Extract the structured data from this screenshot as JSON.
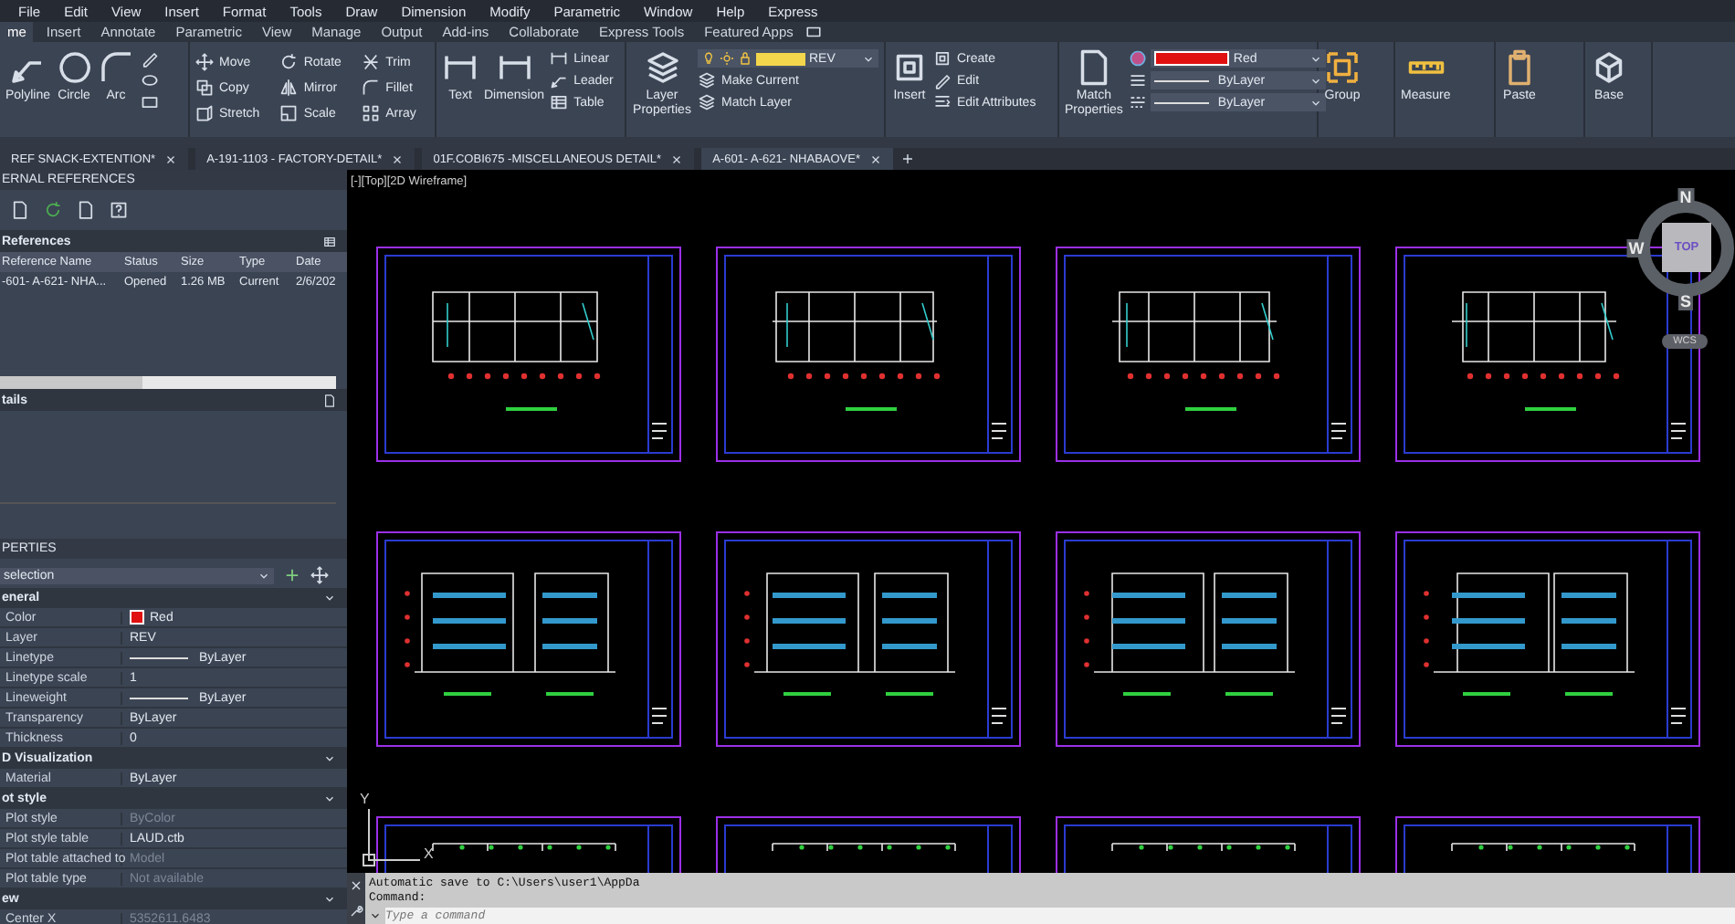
{
  "menu_bar": {
    "items": [
      "File",
      "Edit",
      "View",
      "Insert",
      "Format",
      "Tools",
      "Draw",
      "Dimension",
      "Modify",
      "Parametric",
      "Window",
      "Help",
      "Express"
    ]
  },
  "ribbon_tabs": [
    {
      "label": "me",
      "selected": true
    },
    {
      "label": "Insert",
      "selected": false
    },
    {
      "label": "Annotate",
      "selected": false
    },
    {
      "label": "Parametric",
      "selected": false
    },
    {
      "label": "View",
      "selected": false
    },
    {
      "label": "Manage",
      "selected": false
    },
    {
      "label": "Output",
      "selected": false
    },
    {
      "label": "Add-ins",
      "selected": false
    },
    {
      "label": "Collaborate",
      "selected": false
    },
    {
      "label": "Express Tools",
      "selected": false
    },
    {
      "label": "Featured Apps",
      "selected": false
    }
  ],
  "ribbon": {
    "draw": {
      "buttons": [
        "Polyline",
        "Circle",
        "Arc"
      ]
    },
    "modify": {
      "tools": [
        "Move",
        "Rotate",
        "Trim",
        "Copy",
        "Mirror",
        "Fillet",
        "Stretch",
        "Scale",
        "Array"
      ]
    },
    "annotation": {
      "buttons": [
        "Text",
        "Dimension"
      ],
      "tools": [
        "Linear",
        "Leader",
        "Table"
      ]
    },
    "layers": {
      "button": "Layer Properties",
      "current_layer": "REV",
      "tools": [
        "Make Current",
        "Match Layer"
      ]
    },
    "block": {
      "button": "Insert",
      "tools": [
        "Create",
        "Edit",
        "Edit Attributes"
      ]
    },
    "properties": {
      "button": "Match Properties",
      "color_name": "Red",
      "linetype": "ByLayer",
      "lineweight": "ByLayer"
    },
    "groups": {
      "button": "Group"
    },
    "utilities": {
      "button": "Measure"
    },
    "clipboard": {
      "button": "Paste"
    },
    "view": {
      "button": "Base"
    }
  },
  "document_tabs": [
    {
      "label": "REF SNACK-EXTENTION*",
      "selected": false
    },
    {
      "label": "A-191-1103 - FACTORY-DETAIL*",
      "selected": false
    },
    {
      "label": "01F.COBI675 -MISCELLANEOUS DETAIL*",
      "selected": false
    },
    {
      "label": "A-601- A-621- NHABAOVE*",
      "selected": true
    }
  ],
  "xref_palette": {
    "title": "ERNAL REFERENCES",
    "section": "References",
    "columns": [
      "Reference Name",
      "Status",
      "Size",
      "Type",
      "Date"
    ],
    "rows": [
      [
        "-601- A-621- NHA...",
        "Opened",
        "1.26 MB",
        "Current",
        "2/6/202"
      ]
    ],
    "details_title": "tails"
  },
  "properties_palette": {
    "title": "PERTIES",
    "selection": "selection",
    "groups": [
      {
        "title": "eneral",
        "rows": [
          {
            "label": "Color",
            "value": "Red",
            "kind": "color",
            "disabled": false
          },
          {
            "label": "Layer",
            "value": "REV",
            "kind": "text",
            "disabled": false
          },
          {
            "label": "Linetype",
            "value": "ByLayer",
            "kind": "line",
            "disabled": false
          },
          {
            "label": "Linetype scale",
            "value": "1",
            "kind": "text",
            "disabled": false
          },
          {
            "label": "Lineweight",
            "value": "ByLayer",
            "kind": "line",
            "disabled": false
          },
          {
            "label": "Transparency",
            "value": "ByLayer",
            "kind": "text",
            "disabled": false
          },
          {
            "label": "Thickness",
            "value": "0",
            "kind": "text",
            "disabled": false
          }
        ]
      },
      {
        "title": "D Visualization",
        "rows": [
          {
            "label": "Material",
            "value": "ByLayer",
            "kind": "text",
            "disabled": false
          }
        ]
      },
      {
        "title": "ot style",
        "rows": [
          {
            "label": "Plot style",
            "value": "ByColor",
            "kind": "text",
            "disabled": true
          },
          {
            "label": "Plot style table",
            "value": "LAUD.ctb",
            "kind": "text",
            "disabled": false
          },
          {
            "label": "Plot table attached to",
            "value": "Model",
            "kind": "text",
            "disabled": true
          },
          {
            "label": "Plot table type",
            "value": "Not available",
            "kind": "text",
            "disabled": true
          }
        ]
      },
      {
        "title": "ew",
        "rows": [
          {
            "label": "Center X",
            "value": "5352611.6483",
            "kind": "text",
            "disabled": true
          }
        ]
      }
    ]
  },
  "viewport": {
    "label": "[-][Top][2D Wireframe]"
  },
  "view_cube": {
    "north": "N",
    "west": "W",
    "south": "S",
    "face": "TOP",
    "ucs": "WCS"
  },
  "ucs_icon": {
    "x": "X",
    "y": "Y"
  },
  "command_line": {
    "history": [
      "Automatic save to C:\\Users\\user1\\AppDa",
      "Command:"
    ],
    "placeholder": "Type a command"
  }
}
